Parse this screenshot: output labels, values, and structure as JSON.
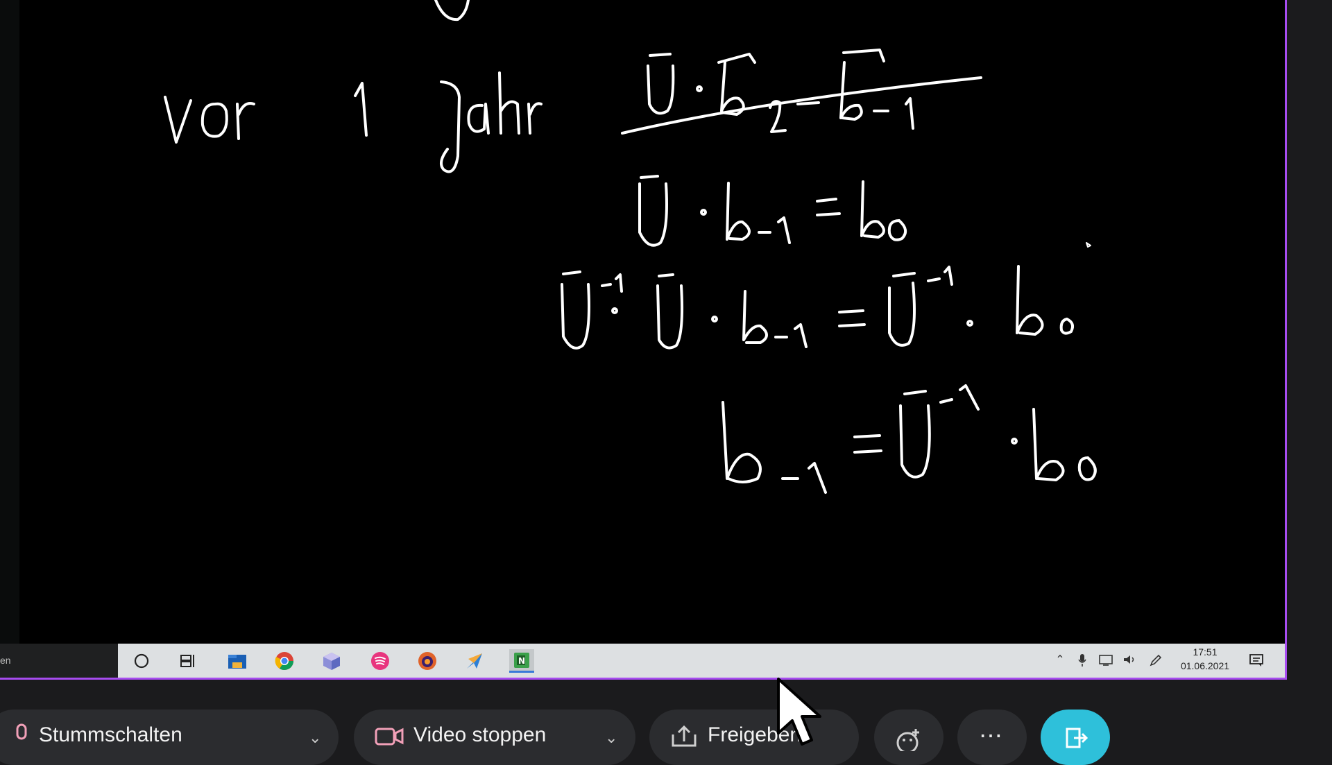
{
  "whiteboard": {
    "line1": "vor   1  Jahr   ū·b₂ = b₋₁ (crossed out)",
    "line2": "ū·b₋₁ = b₀",
    "line3": "ū⁻¹·ū·b₋₁ = ū⁻¹·b₀",
    "line4": "b₋₁ = ū⁻¹·b₀"
  },
  "taskbar": {
    "search_text": "en",
    "icons": [
      "cortana-icon",
      "task-view-icon",
      "file-explorer-icon",
      "chrome-icon",
      "3d-box-icon",
      "spotify-icon",
      "firefox-icon",
      "arrow-app-icon",
      "onenote-icon"
    ],
    "clock_time": "17:51",
    "clock_date": "01.06.2021"
  },
  "meeting_bar": {
    "mute_label": "Stummschalten",
    "video_label": "Video stoppen",
    "share_label": "Freigeben"
  },
  "colors": {
    "accent_border": "#a74cf0",
    "leave_button": "#2ec0da",
    "ink": "#ffffff"
  }
}
